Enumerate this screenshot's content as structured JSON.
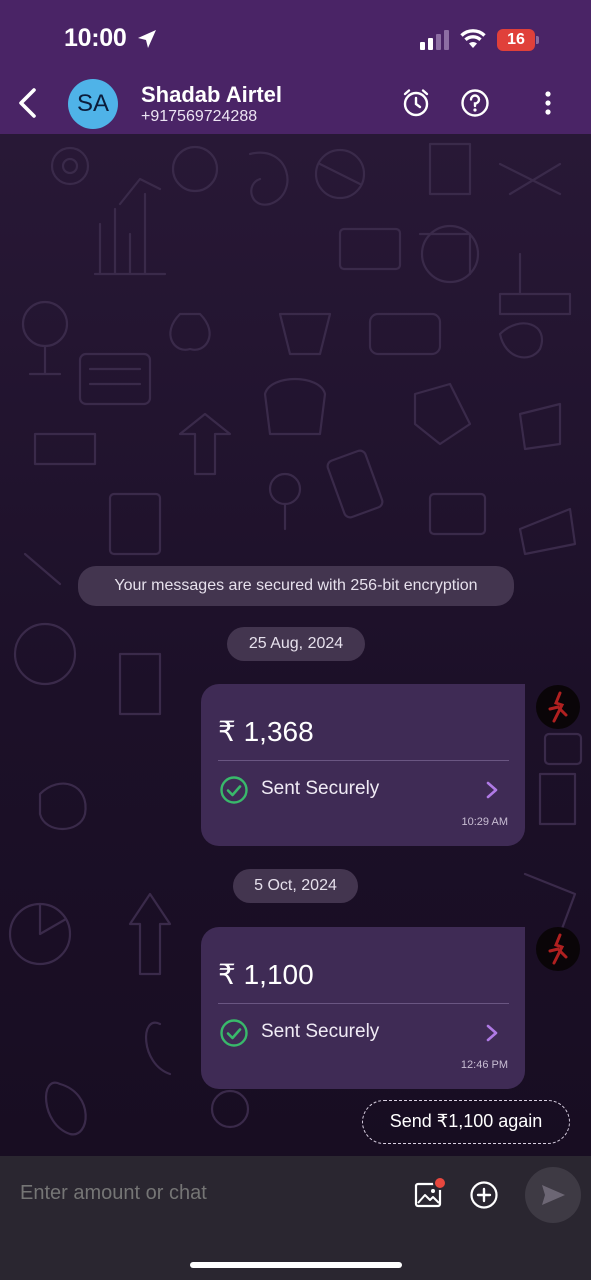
{
  "status": {
    "time": "10:00",
    "battery": "16"
  },
  "header": {
    "avatar_initials": "SA",
    "contact_name": "Shadab Airtel",
    "contact_phone": "+917569724288"
  },
  "chat": {
    "encryption_notice": "Your messages are secured with 256-bit encryption",
    "messages": [
      {
        "date": "25 Aug, 2024",
        "amount": "₹ 1,368",
        "status": "Sent Securely",
        "time": "10:29 AM"
      },
      {
        "date": "5 Oct, 2024",
        "amount": "₹ 1,100",
        "status": "Sent Securely",
        "time": "12:46 PM"
      }
    ],
    "send_again_label": "Send ₹1,100 again"
  },
  "composer": {
    "placeholder": "Enter amount or chat"
  },
  "colors": {
    "header": "#4a2466",
    "bubble": "#3f2b55",
    "accent": "#b07ae6",
    "success": "#39b96b"
  }
}
